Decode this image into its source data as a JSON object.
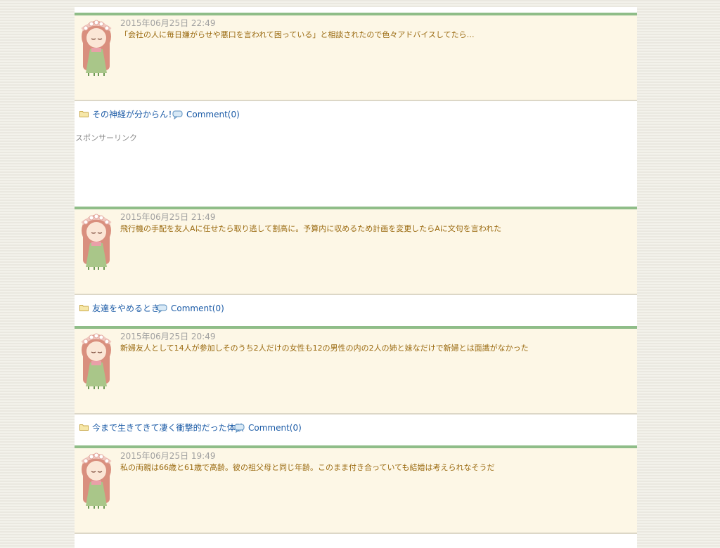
{
  "posts": [
    {
      "date": "2015年06月25日 22:49",
      "text": "「会社の人に毎日嫌がらせや悪口を言われて困っている」と相談されたので色々アドバイスしてたら…",
      "title": "その神経が分からん！",
      "comment": "Comment(0)"
    },
    {
      "date": "2015年06月25日 21:49",
      "text": "飛行機の手配を友人Aに任せたら取り逃して割高に。予算内に収めるため計画を変更したらAに文句を言われた",
      "title": "友達をやめるとき",
      "comment": "Comment(0)"
    },
    {
      "date": "2015年06月25日 20:49",
      "text": "新婦友人として14人が参加しそのうち2人だけの女性も12の男性の内の2人の姉と妹なだけで新婦とは面識がなかった",
      "title": "今まで生きてきて凄く衝撃的だった体験",
      "comment": "Comment(0)"
    },
    {
      "date": "2015年06月25日 19:49",
      "text": "私の両親は66歳と61歳で高齢。彼の祖父母と同じ年齢。このまま付き合っていても結婚は考えられなそうだ"
    }
  ],
  "sponsor_label": "スポンサーリンク",
  "icons": {
    "avatar": "girl-avatar-icon",
    "folder": "folder-icon",
    "comment": "comment-bubble-icon"
  },
  "colors": {
    "accent_bar": "#8fbd88",
    "entry_bg": "#fdf7e6",
    "link": "#1a5aa6",
    "text": "#9a6a10"
  }
}
